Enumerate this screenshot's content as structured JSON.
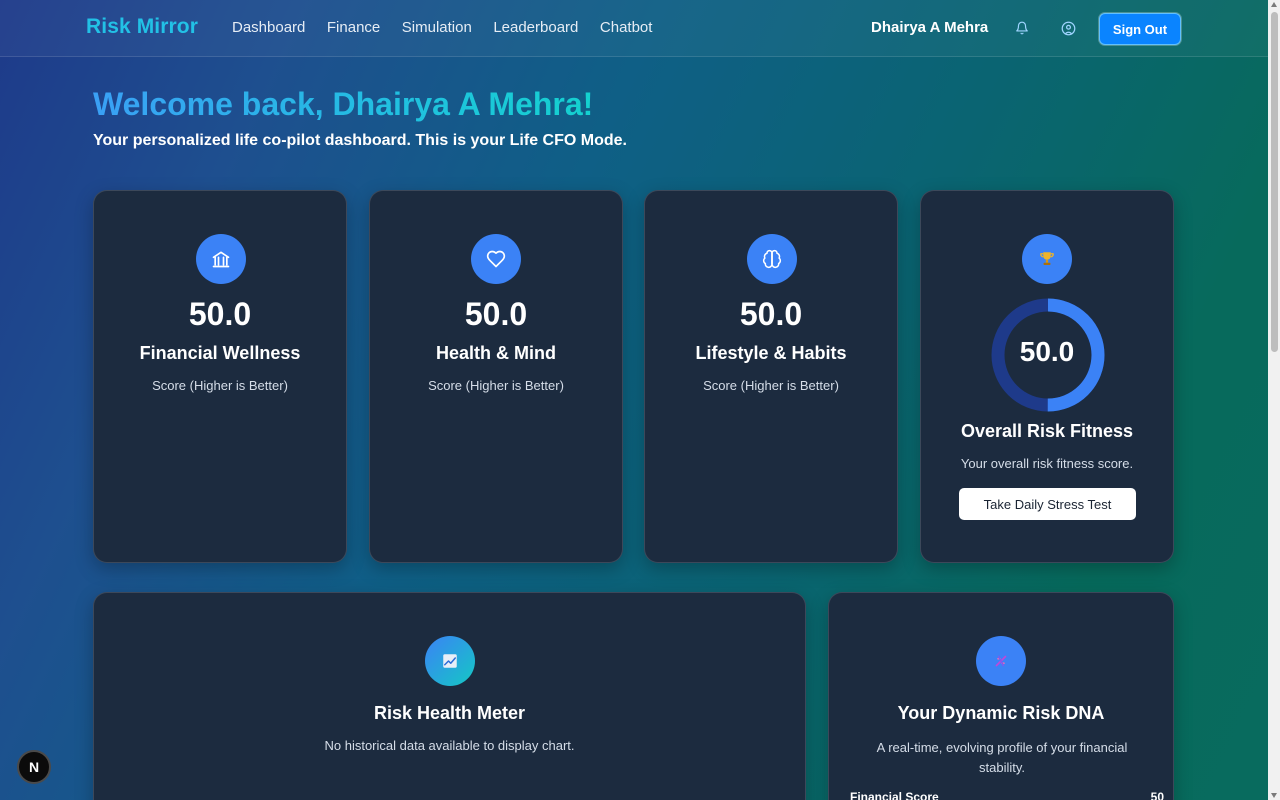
{
  "nav": {
    "brand": "Risk Mirror",
    "links": [
      "Dashboard",
      "Finance",
      "Simulation",
      "Leaderboard",
      "Chatbot"
    ],
    "user_name": "Dhairya A Mehra",
    "sign_out": "Sign Out"
  },
  "header": {
    "welcome": "Welcome back, Dhairya A Mehra!",
    "subtitle": "Your personalized life co-pilot dashboard. This is your Life CFO Mode."
  },
  "cards": [
    {
      "score": "50.0",
      "title": "Financial Wellness",
      "subtitle": "Score (Higher is Better)",
      "icon": "bank-icon"
    },
    {
      "score": "50.0",
      "title": "Health & Mind",
      "subtitle": "Score (Higher is Better)",
      "icon": "heart-icon"
    },
    {
      "score": "50.0",
      "title": "Lifestyle & Habits",
      "subtitle": "Score (Higher is Better)",
      "icon": "brain-icon"
    }
  ],
  "overall": {
    "score": "50.0",
    "progress": 0.5,
    "title": "Overall Risk Fitness",
    "subtitle": "Your overall risk fitness score.",
    "button": "Take Daily Stress Test",
    "icon": "trophy-icon"
  },
  "meter": {
    "title": "Risk Health Meter",
    "subtitle": "No historical data available to display chart.",
    "icon": "chart-icon"
  },
  "dna": {
    "title": "Your Dynamic Risk DNA",
    "subtitle": "A real-time, evolving profile of your financial stability.",
    "row_label": "Financial Score",
    "row_value": "50",
    "icon": "dna-icon"
  },
  "badge": "N",
  "colors": {
    "accent": "#3b82f6",
    "card_bg": "#1c2b3f",
    "brand": "#22c1e6"
  }
}
